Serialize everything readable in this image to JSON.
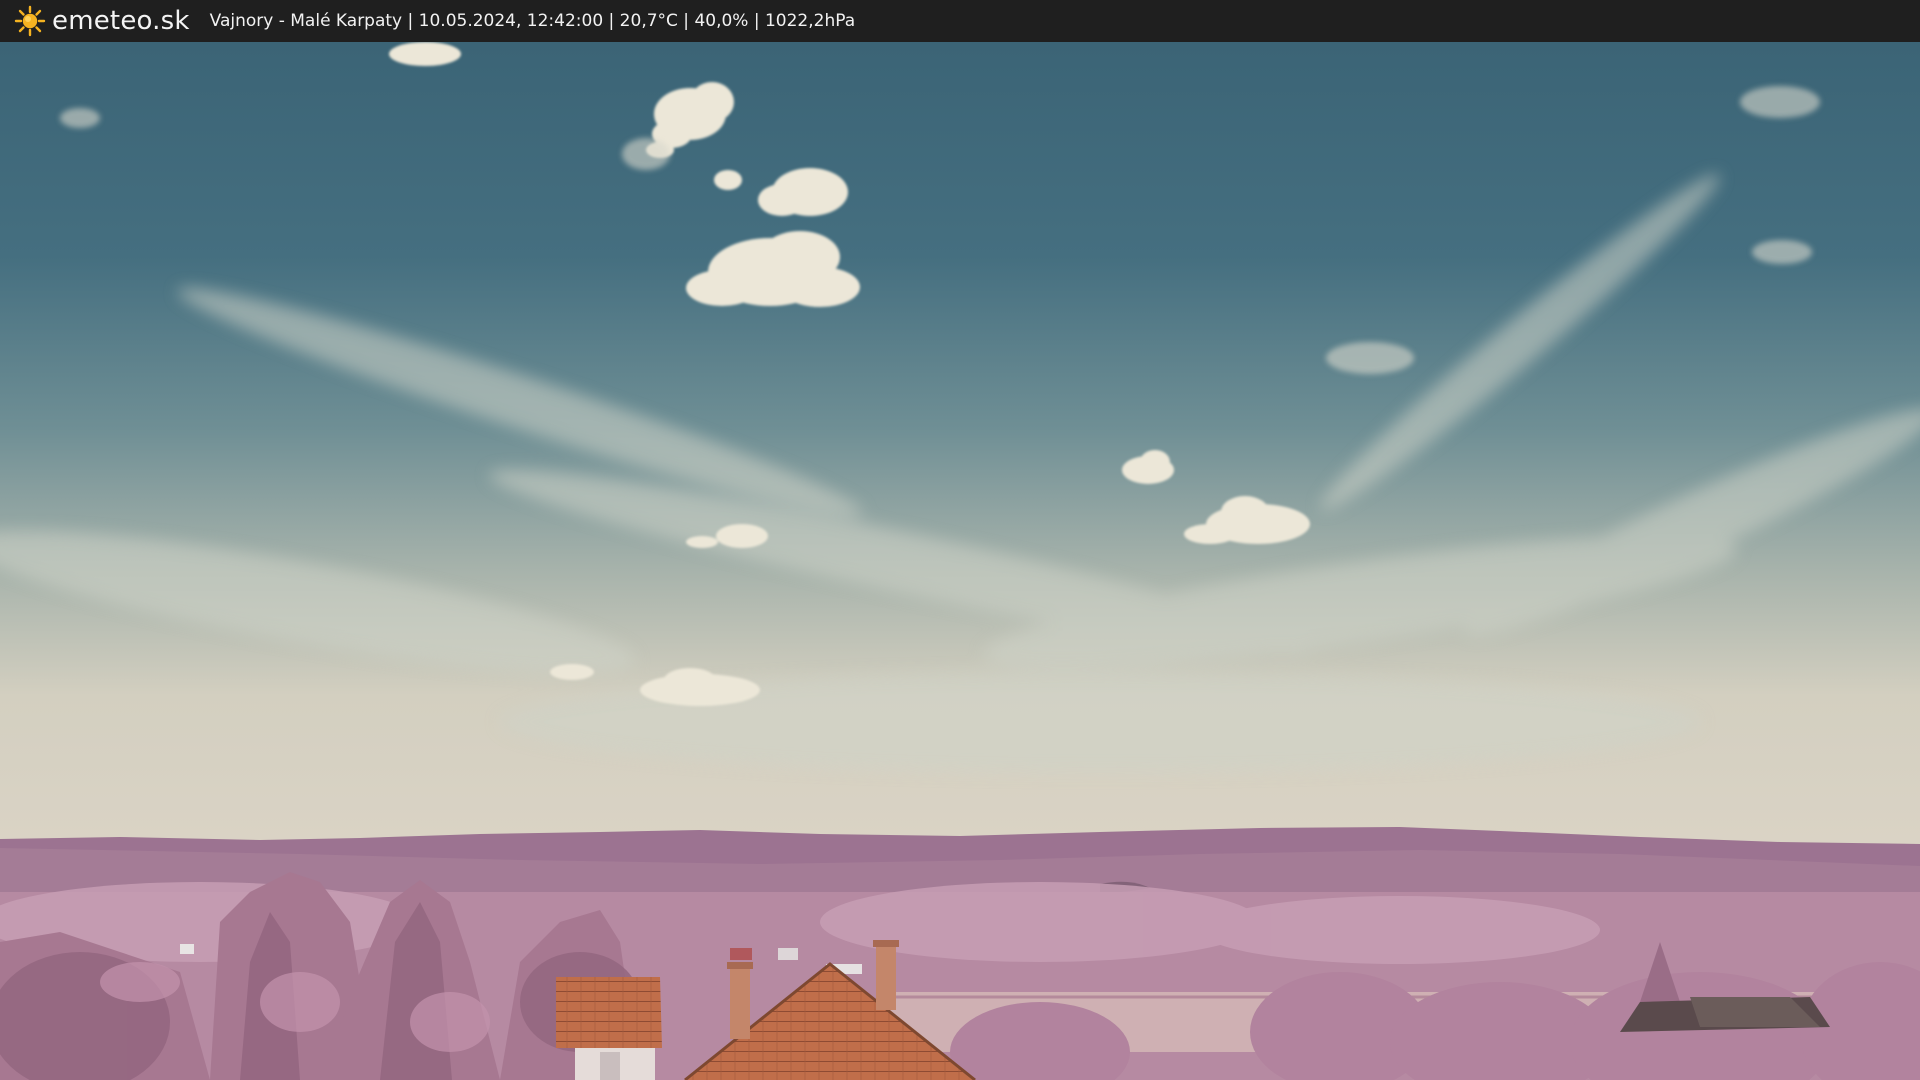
{
  "header": {
    "logo_text": "emeteo.sk",
    "caption": "Vajnory - Malé Karpaty | 10.05.2024, 12:42:00 | 20,7°C | 40,0% | 1022,2hPa"
  },
  "icons": {
    "logo": "sun-icon"
  },
  "colors": {
    "bar_background": "#1f1f1f",
    "sun": "#f5b321",
    "sky_top": "#3d6677",
    "sky_horizon": "#d6d2c4",
    "foliage": "#b07d98",
    "roof": "#c2643f"
  }
}
